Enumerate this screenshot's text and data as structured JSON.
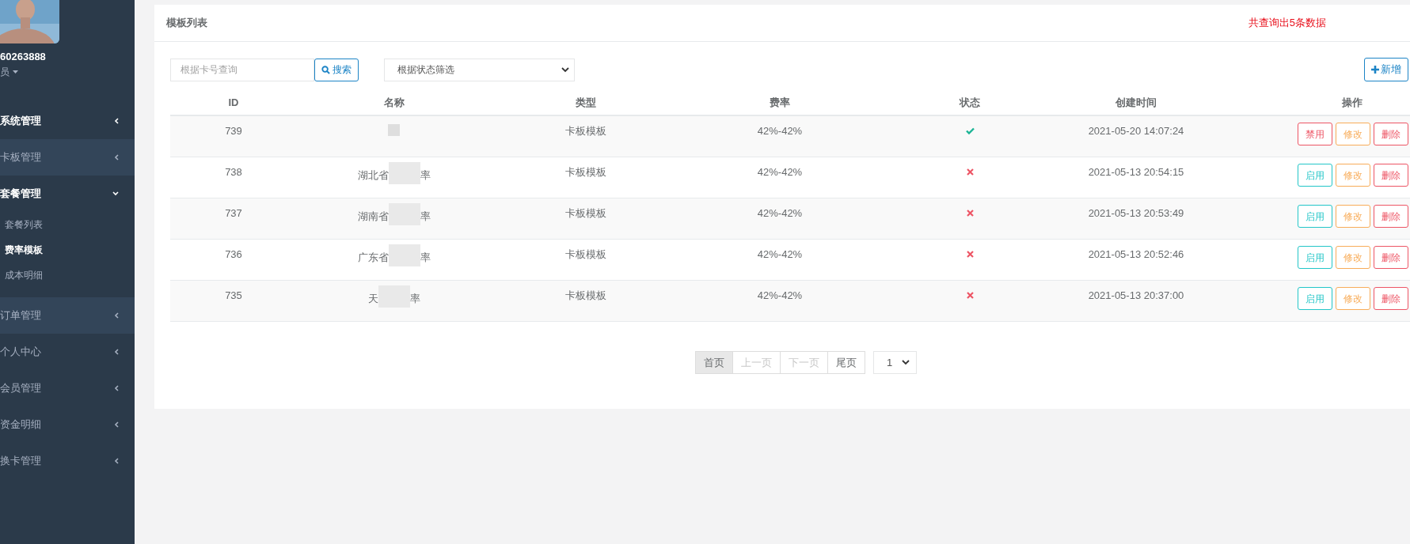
{
  "sidebar": {
    "user_id": "60263888",
    "role": "员",
    "menu": [
      {
        "label": "系统管理",
        "highlight": false,
        "expanded": false,
        "bold": true
      },
      {
        "label": "卡板管理",
        "highlight": true,
        "expanded": false,
        "bold": false
      },
      {
        "label": "套餐管理",
        "highlight": false,
        "expanded": true,
        "bold": true,
        "children": [
          {
            "label": "套餐列表",
            "selected": false
          },
          {
            "label": "费率模板",
            "selected": true
          },
          {
            "label": "成本明细",
            "selected": false
          }
        ]
      },
      {
        "label": "订单管理",
        "highlight": true,
        "expanded": false,
        "bold": false
      },
      {
        "label": "个人中心",
        "highlight": false,
        "expanded": false,
        "bold": false
      },
      {
        "label": "会员管理",
        "highlight": false,
        "expanded": false,
        "bold": false
      },
      {
        "label": "资金明细",
        "highlight": false,
        "expanded": false,
        "bold": false
      },
      {
        "label": "换卡管理",
        "highlight": false,
        "expanded": false,
        "bold": false
      }
    ]
  },
  "panel": {
    "title": "模板列表",
    "result_count": "共查询出5条数据"
  },
  "toolbar": {
    "search_placeholder": "根据卡号查询",
    "search_button": "搜索",
    "status_filter": "根据状态筛选",
    "add_button": "新增"
  },
  "table": {
    "columns": [
      "ID",
      "名称",
      "类型",
      "费率",
      "状态",
      "创建时间",
      "操作"
    ],
    "rows": [
      {
        "id": "739",
        "name_start": "",
        "name_end": "",
        "type": "卡板模板",
        "rate": "42%-42%",
        "enabled": true,
        "created": "2021-05-20 14:07:24",
        "actions": [
          {
            "label": "禁用",
            "kind": "disable"
          },
          {
            "label": "修改",
            "kind": "edit"
          },
          {
            "label": "删除",
            "kind": "delete"
          }
        ]
      },
      {
        "id": "738",
        "name_start": "湖北省",
        "name_end": "率",
        "type": "卡板模板",
        "rate": "42%-42%",
        "enabled": false,
        "created": "2021-05-13 20:54:15",
        "actions": [
          {
            "label": "启用",
            "kind": "enable"
          },
          {
            "label": "修改",
            "kind": "edit"
          },
          {
            "label": "删除",
            "kind": "delete"
          }
        ]
      },
      {
        "id": "737",
        "name_start": "湖南省",
        "name_end": "率",
        "type": "卡板模板",
        "rate": "42%-42%",
        "enabled": false,
        "created": "2021-05-13 20:53:49",
        "actions": [
          {
            "label": "启用",
            "kind": "enable"
          },
          {
            "label": "修改",
            "kind": "edit"
          },
          {
            "label": "删除",
            "kind": "delete"
          }
        ]
      },
      {
        "id": "736",
        "name_start": "广东省",
        "name_end": "率",
        "type": "卡板模板",
        "rate": "42%-42%",
        "enabled": false,
        "created": "2021-05-13 20:52:46",
        "actions": [
          {
            "label": "启用",
            "kind": "enable"
          },
          {
            "label": "修改",
            "kind": "edit"
          },
          {
            "label": "删除",
            "kind": "delete"
          }
        ]
      },
      {
        "id": "735",
        "name_start": "天",
        "name_end": "率",
        "type": "卡板模板",
        "rate": "42%-42%",
        "enabled": false,
        "created": "2021-05-13 20:37:00",
        "actions": [
          {
            "label": "启用",
            "kind": "enable"
          },
          {
            "label": "修改",
            "kind": "edit"
          },
          {
            "label": "删除",
            "kind": "delete"
          }
        ]
      }
    ]
  },
  "pagination": {
    "pages": [
      {
        "label": "首页",
        "disabled": false,
        "selected": true
      },
      {
        "label": "上一页",
        "disabled": true,
        "selected": false
      },
      {
        "label": "下一页",
        "disabled": true,
        "selected": false
      },
      {
        "label": "尾页",
        "disabled": false,
        "selected": false
      }
    ],
    "page_select": "1"
  }
}
